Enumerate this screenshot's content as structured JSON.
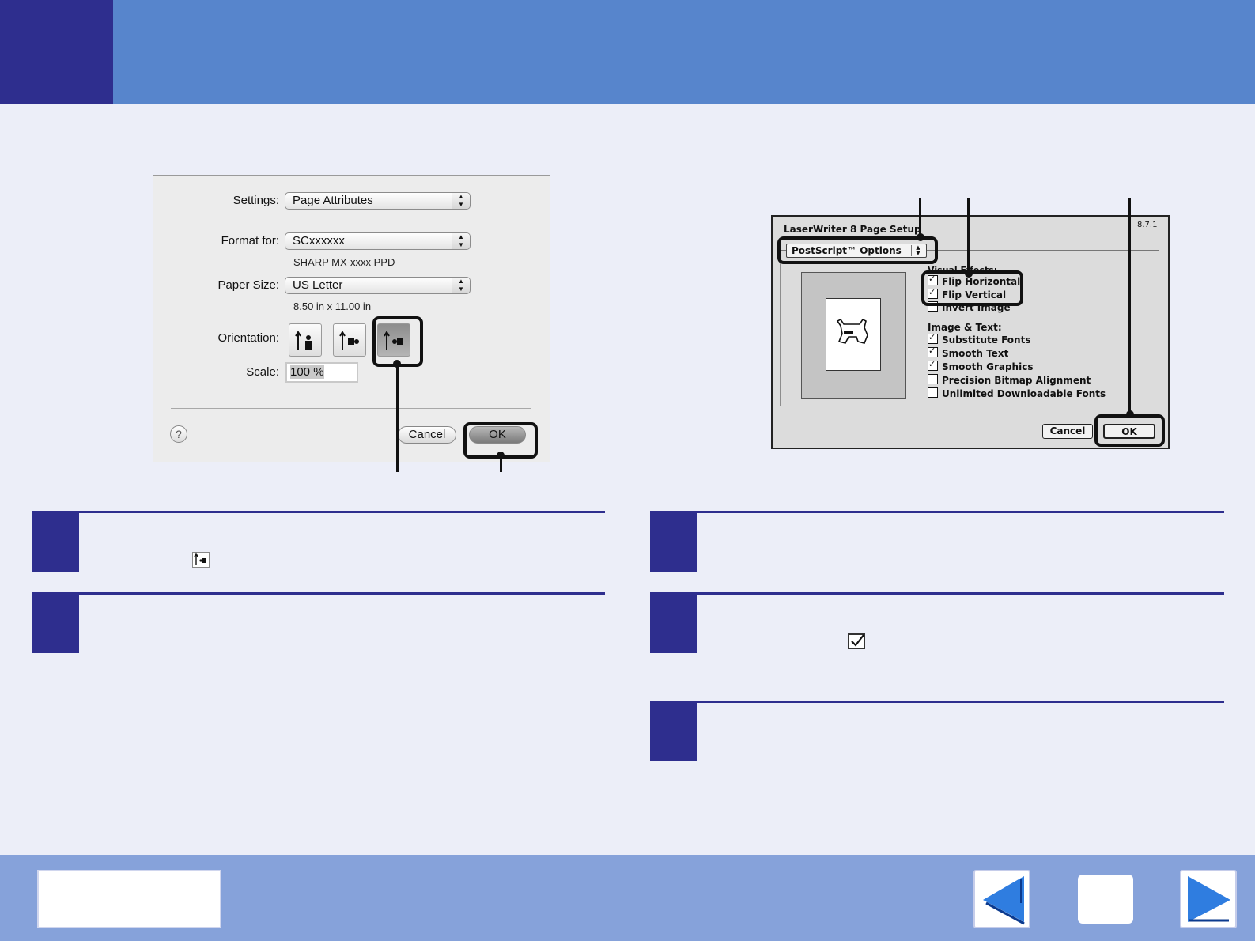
{
  "mac_dialog": {
    "settings_label": "Settings:",
    "settings_value": "Page Attributes",
    "format_label": "Format for:",
    "format_value": "SCxxxxxx",
    "format_sub": "SHARP MX-xxxx PPD",
    "paper_label": "Paper Size:",
    "paper_value": "US Letter",
    "paper_sub": "8.50 in x 11.00 in",
    "orientation_label": "Orientation:",
    "scale_label": "Scale:",
    "scale_value": "100 %",
    "help_label": "?",
    "cancel_label": "Cancel",
    "ok_label": "OK"
  },
  "lw_dialog": {
    "title": "LaserWriter 8 Page Setup",
    "version": "8.7.1",
    "popup_value": "PostScript™ Options",
    "visual_effects_heading": "Visual Effects:",
    "visual_effects": [
      {
        "label": "Flip Horizontal",
        "checked": true
      },
      {
        "label": "Flip Vertical",
        "checked": true
      },
      {
        "label": "Invert Image",
        "checked": false
      }
    ],
    "image_text_heading": "Image & Text:",
    "image_text": [
      {
        "label": "Substitute Fonts",
        "checked": true
      },
      {
        "label": "Smooth Text",
        "checked": true
      },
      {
        "label": "Smooth Graphics",
        "checked": true
      },
      {
        "label": "Precision Bitmap Alignment",
        "checked": false
      },
      {
        "label": "Unlimited Downloadable Fonts",
        "checked": false
      }
    ],
    "cancel_label": "Cancel",
    "ok_label": "OK"
  },
  "colors": {
    "header_blue": "#5785cc",
    "accent_navy": "#2e2e8e",
    "page_bg": "#eceef8",
    "footer_blue": "#86a2da"
  },
  "icons": {
    "prev": "left-triangle-arrow",
    "next": "right-triangle-arrow",
    "home": "blank-square"
  }
}
